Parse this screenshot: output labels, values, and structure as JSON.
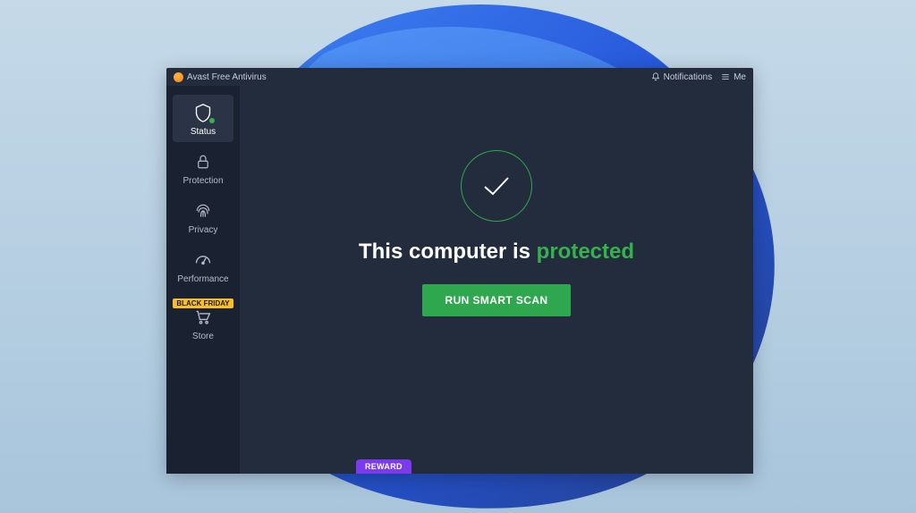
{
  "app": {
    "title": "Avast Free Antivirus"
  },
  "header": {
    "notifications_label": "Notifications",
    "menu_label": "Me"
  },
  "sidebar": {
    "items": [
      {
        "label": "Status"
      },
      {
        "label": "Protection"
      },
      {
        "label": "Privacy"
      },
      {
        "label": "Performance"
      },
      {
        "label": "Store",
        "badge": "BLACK FRIDAY"
      }
    ]
  },
  "main": {
    "status_prefix": "This computer is ",
    "status_word": "protected",
    "scan_button": "RUN SMART SCAN",
    "reward_label": "REWARD"
  },
  "colors": {
    "accent_green": "#2fa74e",
    "badge_yellow": "#fbbf24",
    "reward_purple": "#7c3aed"
  }
}
